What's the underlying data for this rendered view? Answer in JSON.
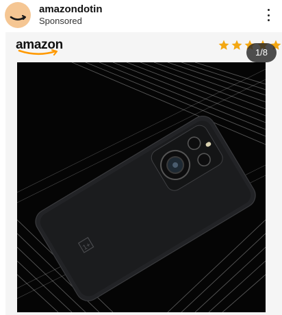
{
  "post": {
    "account_name": "amazondotin",
    "sponsored_label": "Sponsored"
  },
  "ad": {
    "brand_word": "amazon",
    "rating_stars": 5,
    "rating_display": "filled",
    "carousel_counter": "1/8",
    "product_logo_text": "1+"
  },
  "colors": {
    "avatar_bg": "#f5c693",
    "amazon_smile": "#ff9900",
    "star": "#f3a712",
    "card_bg": "#f5f5f5",
    "image_bg": "#000000"
  },
  "icons": {
    "more": "more-vertical-icon",
    "star": "star-icon",
    "smile": "amazon-smile-icon"
  }
}
